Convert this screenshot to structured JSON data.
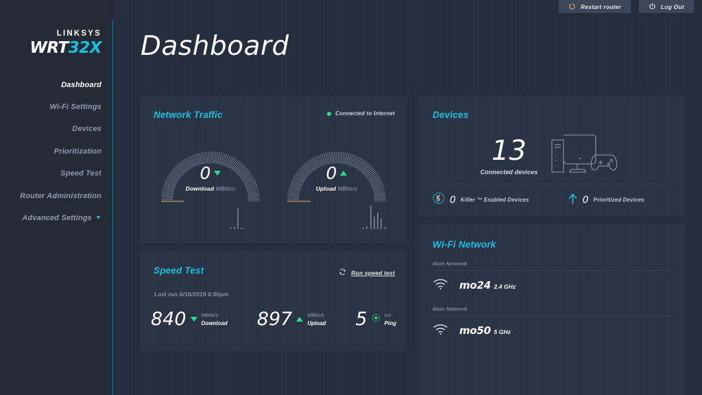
{
  "brand": {
    "logo_top": "LINKSYS",
    "logo_model_primary": "WRT",
    "logo_model_accent": "32X",
    "accent_color": "#16c0e0"
  },
  "topbar": {
    "restart_label": "Restart router",
    "restart_icon": "restart-icon",
    "logout_label": "Log Out",
    "logout_icon": "power-icon"
  },
  "header": {
    "title": "Dashboard"
  },
  "sidebar": {
    "items": [
      {
        "label": "Dashboard",
        "active": true
      },
      {
        "label": "Wi-Fi Settings",
        "active": false
      },
      {
        "label": "Devices",
        "active": false
      },
      {
        "label": "Prioritization",
        "active": false
      },
      {
        "label": "Speed Test",
        "active": false
      },
      {
        "label": "Router Administration",
        "active": false
      },
      {
        "label": "Advanced Settings",
        "active": false,
        "chevron": "chevron-down-icon"
      }
    ]
  },
  "network_traffic": {
    "title": "Network Traffic",
    "status_label": "Connected to Internet",
    "status_color": "#28e08a",
    "download": {
      "value": "0",
      "label": "Download",
      "unit": "MBits/s",
      "direction": "down"
    },
    "upload": {
      "value": "0",
      "label": "Upload",
      "unit": "MBits/s",
      "direction": "up"
    }
  },
  "speed_test": {
    "title": "Speed Test",
    "run_label": "Run speed test",
    "run_icon": "refresh-icon",
    "last_run": "Last run 6/16/2019 8:50pm",
    "results": [
      {
        "value": "840",
        "unit": "MBits/s",
        "label": "Download",
        "icon": "triangle-down-icon"
      },
      {
        "value": "897",
        "unit": "MBits/s",
        "label": "Upload",
        "icon": "triangle-up-icon"
      },
      {
        "value": "5",
        "unit": "ms",
        "label": "Ping",
        "icon": "ping-icon"
      }
    ]
  },
  "devices": {
    "title": "Devices",
    "connected_count": "13",
    "connected_label": "Connected devices",
    "illustration": "pc-monitor-gamepad-icon",
    "stats": [
      {
        "count": "0",
        "label": "Killer ™ Enabled Devices",
        "icon": "killer-logo-icon"
      },
      {
        "count": "0",
        "label": "Prioritized Devices",
        "icon": "arrow-up-icon"
      }
    ]
  },
  "wifi_network": {
    "title": "Wi-Fi Network",
    "networks": [
      {
        "group": "Main Network",
        "ssid": "mo24",
        "band": "2.4 GHz",
        "icon": "wifi-icon"
      },
      {
        "group": "Main Network",
        "ssid": "mo50",
        "band": "5 GHz",
        "icon": "wifi-icon"
      }
    ]
  }
}
